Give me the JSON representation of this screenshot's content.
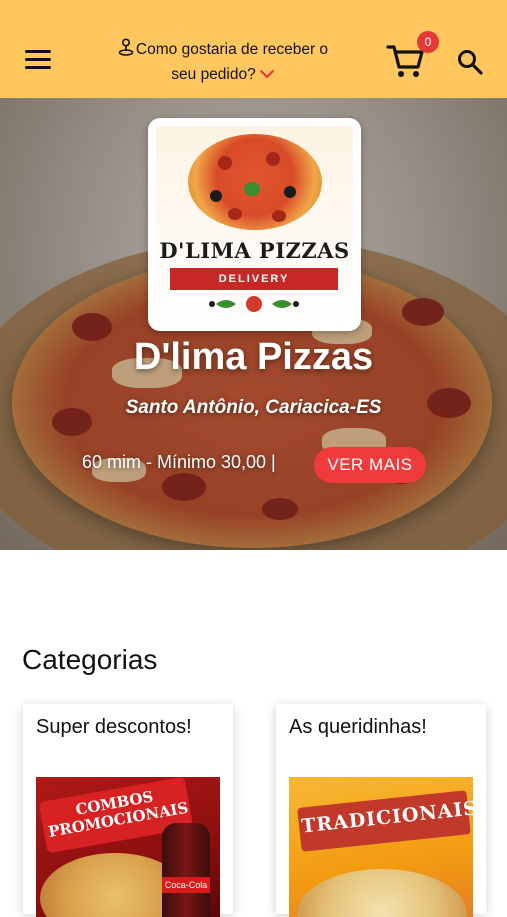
{
  "header": {
    "delivery_prompt": "Como gostaria de receber o seu pedido?",
    "cart_count": "0",
    "icons": [
      "menu-icon",
      "pin-icon",
      "chevron-down-icon",
      "cart-icon",
      "search-icon"
    ]
  },
  "store": {
    "logo_title": "D'LIMA PIZZAS",
    "logo_subtitle": "DELIVERY",
    "name": "D'lima Pizzas",
    "location": "Santo Antônio, Cariacica-ES",
    "meta": "60 mim - Mínimo 30,00 |",
    "more_button": "VER MAIS"
  },
  "categories": {
    "title": "Categorias",
    "items": [
      {
        "label": "Super descontos!",
        "image_text": "COMBOS PROMOCIONAIS",
        "image_subtext": "Coca-Cola"
      },
      {
        "label": "As queridinhas!",
        "image_text": "TRADICIONAIS"
      }
    ]
  },
  "colors": {
    "header_bg": "#ffc75e",
    "accent_red": "#ef3b3b",
    "badge_red": "#e53935"
  }
}
